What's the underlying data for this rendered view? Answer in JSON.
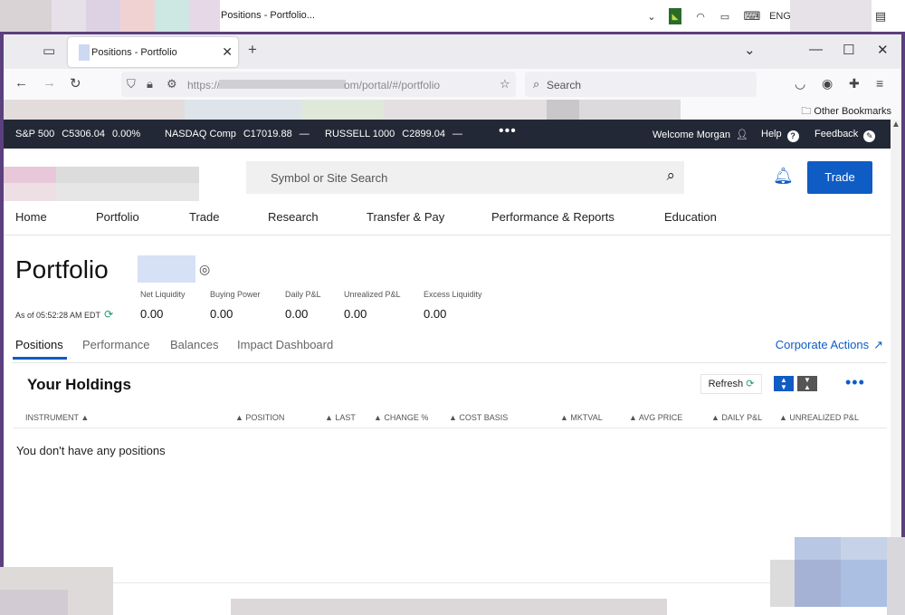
{
  "os": {
    "tab_title": "Positions - Portfolio...",
    "language": "ENG",
    "notification_count": "1"
  },
  "browser": {
    "tab_title": "Positions - Portfolio",
    "url_prefix": "https://",
    "url_path": "om/portal/#/portfolio",
    "search_placeholder": "Search",
    "other_bookmarks": "Other Bookmarks"
  },
  "ticker": {
    "items": [
      {
        "name": "S&P 500",
        "value": "C5306.04",
        "change": "0.00%"
      },
      {
        "name": "NASDAQ Comp",
        "value": "C17019.88",
        "change": "—"
      },
      {
        "name": "RUSSELL 1000",
        "value": "C2899.04",
        "change": "—"
      }
    ],
    "welcome": "Welcome Morgan",
    "help": "Help",
    "feedback": "Feedback"
  },
  "header": {
    "search_placeholder": "Symbol or Site Search",
    "trade_label": "Trade"
  },
  "main_nav": [
    "Home",
    "Portfolio",
    "Trade",
    "Research",
    "Transfer & Pay",
    "Performance & Reports",
    "Education"
  ],
  "portfolio": {
    "title": "Portfolio",
    "as_of": "As of 05:52:28 AM EDT",
    "metrics": [
      {
        "label": "Net Liquidity",
        "value": "0.00"
      },
      {
        "label": "Buying Power",
        "value": "0.00"
      },
      {
        "label": "Daily P&L",
        "value": "0.00"
      },
      {
        "label": "Unrealized P&L",
        "value": "0.00"
      },
      {
        "label": "Excess Liquidity",
        "value": "0.00"
      }
    ]
  },
  "subtabs": [
    "Positions",
    "Performance",
    "Balances",
    "Impact Dashboard"
  ],
  "corporate_actions": "Corporate Actions",
  "holdings": {
    "title": "Your Holdings",
    "refresh_label": "Refresh",
    "columns": [
      "INSTRUMENT",
      "POSITION",
      "LAST",
      "CHANGE %",
      "COST BASIS",
      "MKTVAL",
      "AVG PRICE",
      "DAILY P&L",
      "UNREALIZED P&L"
    ],
    "empty_message": "You don't have any positions"
  },
  "colors": {
    "accent": "#0f5cc4",
    "ticker_bg": "#232836",
    "refresh_green": "#1f9b68"
  }
}
